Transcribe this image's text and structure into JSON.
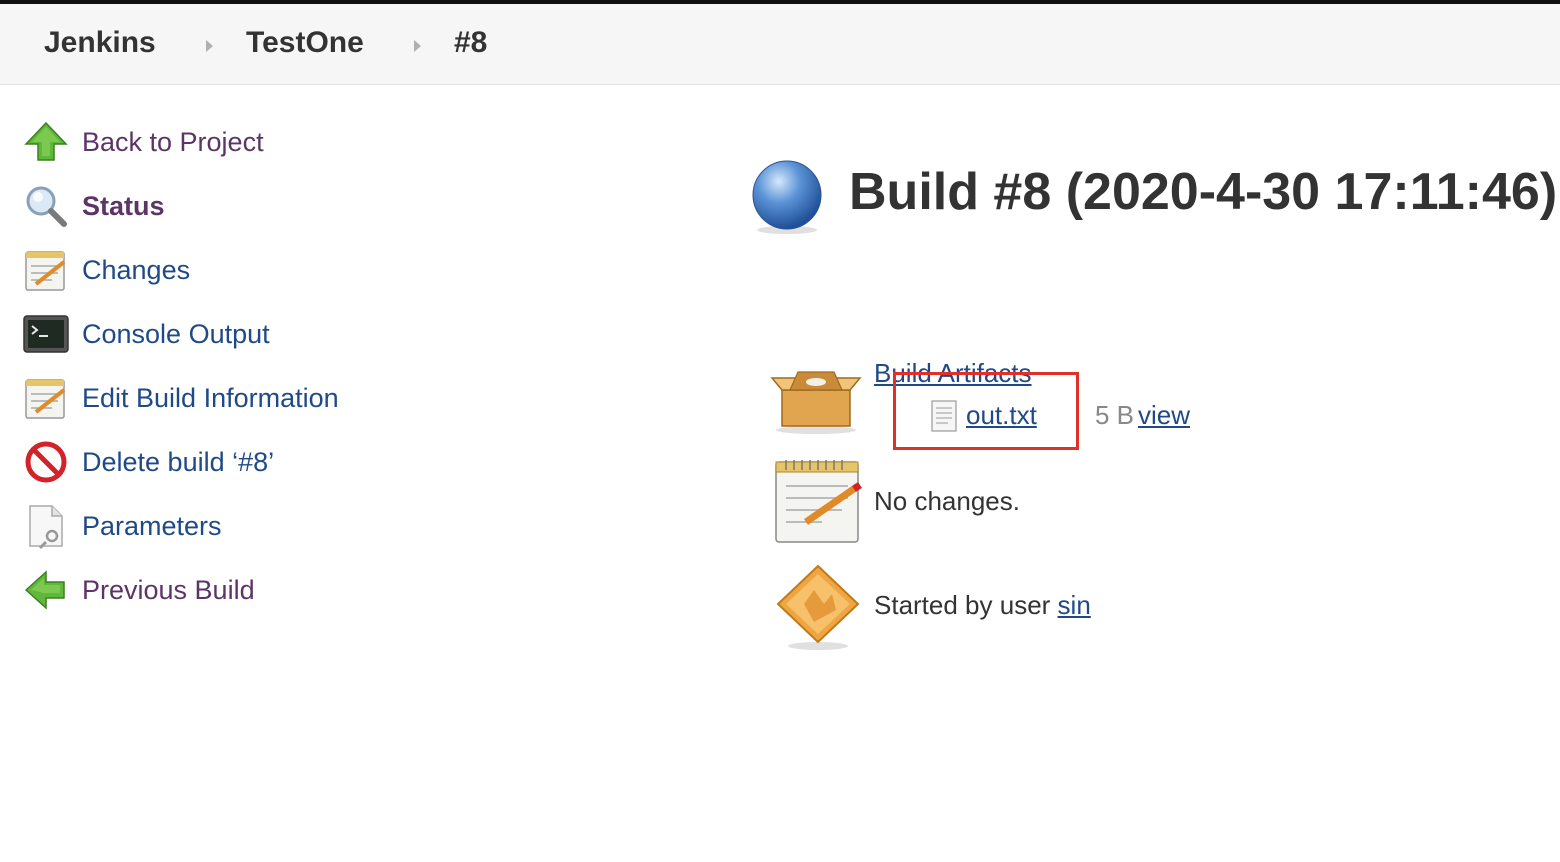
{
  "breadcrumb": {
    "items": [
      "Jenkins",
      "TestOne",
      "#8"
    ]
  },
  "sidebar": {
    "items": [
      {
        "label": "Back to Project",
        "icon": "up-arrow-icon"
      },
      {
        "label": "Status",
        "icon": "magnifier-icon"
      },
      {
        "label": "Changes",
        "icon": "notepad-icon"
      },
      {
        "label": "Console Output",
        "icon": "terminal-icon"
      },
      {
        "label": "Edit Build Information",
        "icon": "notepad-icon"
      },
      {
        "label": "Delete build ‘#8’",
        "icon": "no-entry-icon"
      },
      {
        "label": "Parameters",
        "icon": "document-wrench-icon"
      },
      {
        "label": "Previous Build",
        "icon": "left-arrow-icon"
      }
    ]
  },
  "main": {
    "title": "Build #8 (2020-4-30 17:11:46)",
    "status_color": "#3a6fb8",
    "artifacts": {
      "heading": "Build Artifacts",
      "files": [
        {
          "name": "out.txt",
          "size": "5 B",
          "view_label": "view"
        }
      ]
    },
    "changes": "No changes.",
    "cause": {
      "prefix": "Started by user ",
      "user": "sin"
    }
  },
  "colors": {
    "link": "#204a87",
    "visited": "#5c3566",
    "highlight": "#e0302a"
  }
}
